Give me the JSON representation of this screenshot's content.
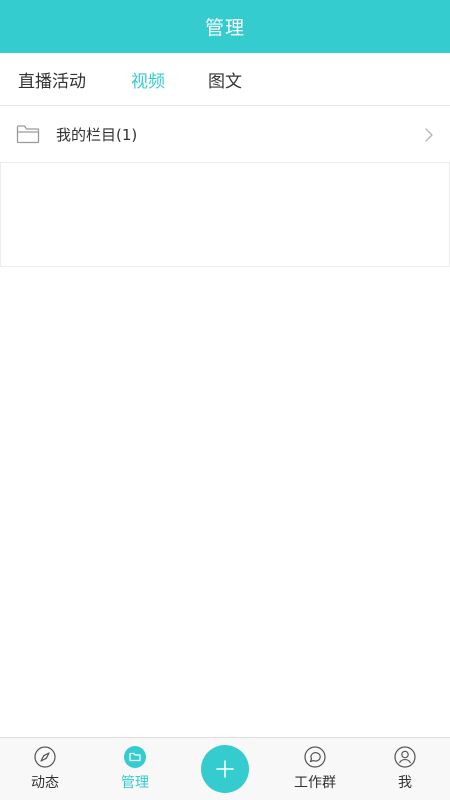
{
  "header": {
    "title": "管理"
  },
  "tabs": [
    {
      "label": "直播活动",
      "active": false
    },
    {
      "label": "视频",
      "active": true
    },
    {
      "label": "图文",
      "active": false
    }
  ],
  "list": {
    "items": [
      {
        "label": "我的栏目(1)",
        "icon": "folder-icon"
      }
    ]
  },
  "tabbar": {
    "items": [
      {
        "label": "动态",
        "icon": "compass-icon",
        "active": false
      },
      {
        "label": "管理",
        "icon": "folder-icon",
        "active": true
      },
      {
        "label": "工作群",
        "icon": "chat-bubble-icon",
        "active": false
      },
      {
        "label": "我",
        "icon": "user-icon",
        "active": false
      }
    ],
    "add_icon": "plus-icon"
  },
  "colors": {
    "accent": "#35cccf",
    "text": "#333333",
    "divider": "#e6e6e6"
  }
}
